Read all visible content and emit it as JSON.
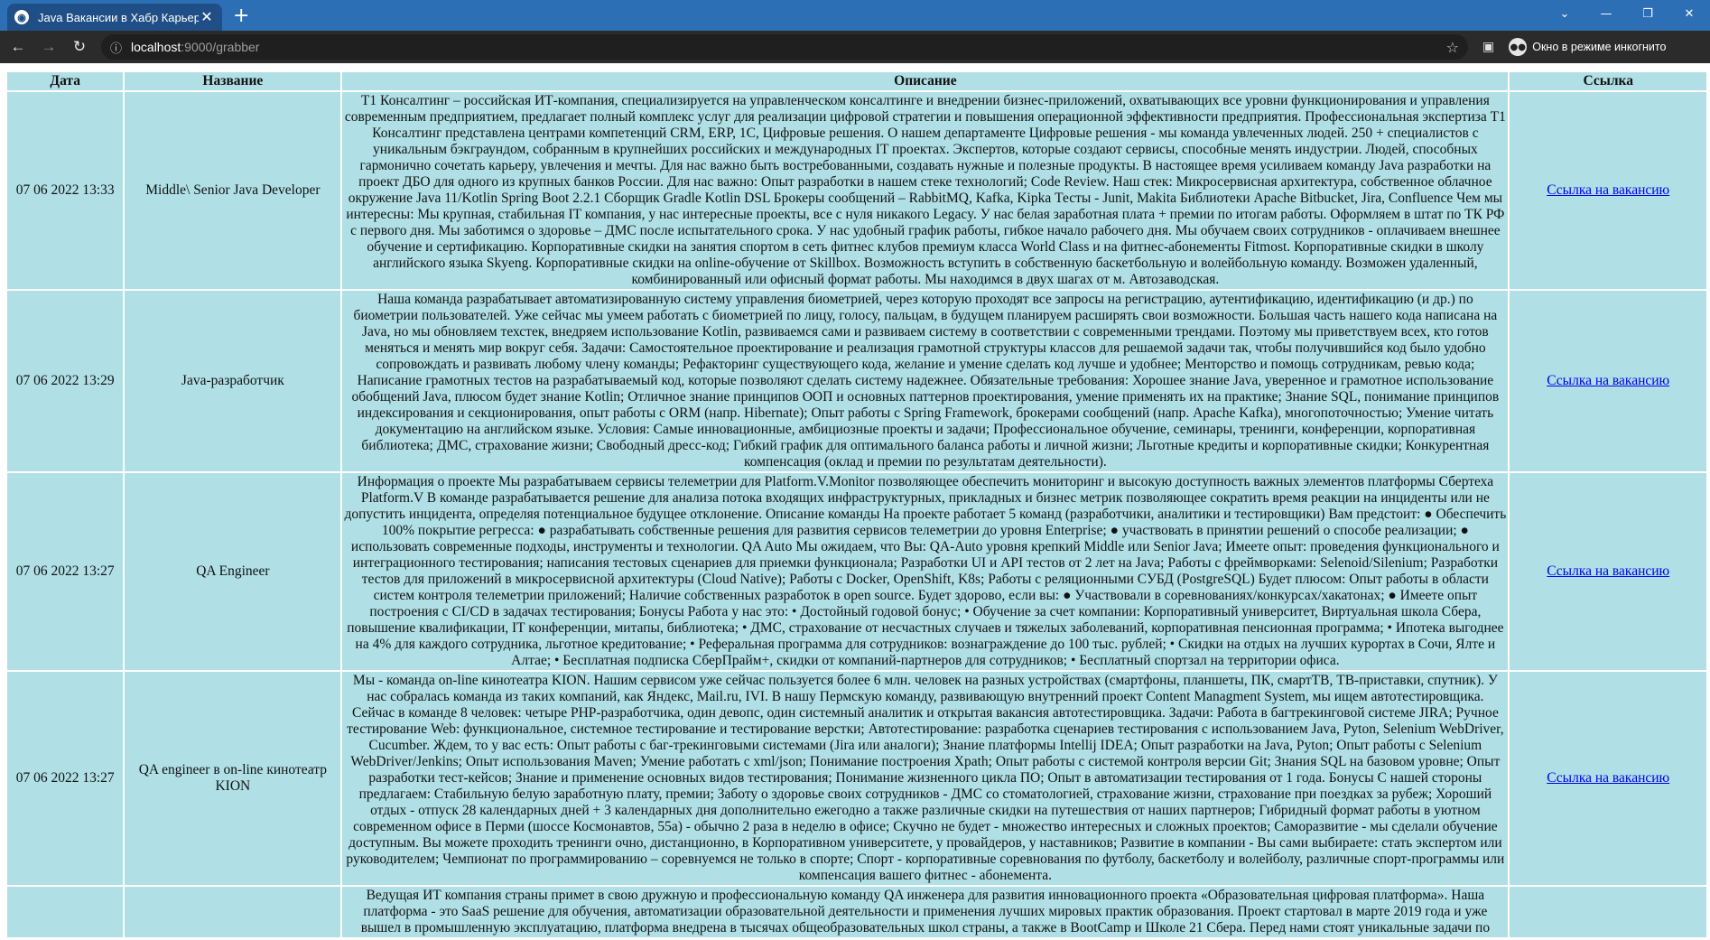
{
  "browser": {
    "tab_title": "Java Вакансии в Хабр Карьера",
    "url_host": "localhost",
    "url_path": ":9000/grabber",
    "incognito_label": "Окно в режиме инкогнито"
  },
  "table": {
    "headers": [
      "Дата",
      "Название",
      "Описание",
      "Ссылка"
    ],
    "rows": [
      {
        "date": "07 06 2022 13:33",
        "name": "Middle\\ Senior Java Developer",
        "description": "Т1 Консалтинг – российская ИТ-компания, специализируется на управленческом консалтинге и внедрении бизнес-приложений, охватывающих все уровни функционирования и управления современным предприятием, предлагает полный комплекс услуг для реализации цифровой стратегии и повышения операционной эффективности предприятия. Профессиональная экспертиза Т1 Консалтинг представлена центрами компетенций CRM, ERP, 1С, Цифровые решения. О нашем департаменте Цифровые решения - мы команда увлеченных людей. 250 + специалистов с уникальным бэкграундом, собранным в крупнейших российских и международных IT проектах. Экспертов, которые создают сервисы, способные менять индустрии. Людей, способных гармонично сочетать карьеру, увлечения и мечты. Для нас важно быть востребованными, создавать нужные и полезные продукты. В настоящее время усиливаем команду Java разработки на проект ДБО для одного из крупных банков России. Для нас важно: Опыт разработки в нашем стеке технологий; Code Review. Наш стек: Микросервисная архитектура, собственное облачное окружение Java 11/Kotlin Spring Boot 2.2.1 Сборщик Gradle Kotlin DSL Брокеры сообщений – RabbitMQ, Kafka, Kipka Тесты - Junit, Makita Библиотеки Apache Bitbucket, Jira, Confluence Чем мы интересны: Мы крупная, стабильная IT компания, у нас интересные проекты, все с нуля никакого Legacy. У нас белая заработная плата + премии по итогам работы. Оформляем в штат по ТК РФ с первого дня. Мы заботимся о здоровье – ДМС после испытательного срока. У нас удобный график работы, гибкое начало рабочего дня. Мы обучаем своих сотрудников - оплачиваем внешнее обучение и сертификацию. Корпоративные скидки на занятия спортом в сеть фитнес клубов премиум класса World Class и на фитнес-абонементы Fitmost. Корпоративные скидки в школу английского языка Skyeng. Корпоративные скидки на online-обучение от Skillbox. Возможность вступить в собственную баскетбольную и волейбольную команду. Возможен удаленный, комбинированный или офисный формат работы. Мы находимся в двух шагах от м. Автозаводская.",
        "link": "Ссылка на вакансию"
      },
      {
        "date": "07 06 2022 13:29",
        "name": "Java-разработчик",
        "description": "Наша команда разрабатывает автоматизированную систему управления биометрией, через которую проходят все запросы на регистрацию, аутентификацию, идентификацию (и др.) по биометрии пользователей. Уже сейчас мы умеем работать с биометрией по лицу, голосу, пальцам, в будущем планируем расширять свои возможности. Большая часть нашего кода написана на Java, но мы обновляем техстек, внедряем использование Kotlin, развиваемся сами и развиваем систему в соответствии с современными трендами. Поэтому мы приветствуем всех, кто готов меняться и менять мир вокруг себя. Задачи: Самостоятельное проектирование и реализация грамотной структуры классов для решаемой задачи так, чтобы получившийся код было удобно сопровождать и развивать любому члену команды; Рефакторинг существующего кода, желание и умение сделать код лучше и удобнее; Менторство и помощь сотрудникам, ревью кода; Написание грамотных тестов на разрабатываемый код, которые позволяют сделать систему надежнее. Обязательные требования: Хорошее знание Java, уверенное и грамотное использование обобщений Java, плюсом будет знание Kotlin; Отличное знание принципов ООП и основных паттернов проектирования, умение применять их на практике; Знание SQL, понимание принципов индексирования и секционирования, опыт работы с ORM (напр. Hibernate); Опыт работы с Spring Framework, брокерами сообщений (напр. Apache Kafka), многопоточностью; Умение читать документацию на английском языке. Условия: Самые инновационные, амбициозные проекты и задачи; Профессиональное обучение, семинары, тренинги, конференции, корпоративная библиотека; ДМС, страхование жизни; Свободный дресс-код; Гибкий график для оптимального баланса работы и личной жизни; Льготные кредиты и корпоративные скидки; Конкурентная компенсация (оклад и премии по результатам деятельности).",
        "link": "Ссылка на вакансию"
      },
      {
        "date": "07 06 2022 13:27",
        "name": "QA Engineer",
        "description": "Информация о проекте Мы разрабатываем сервисы телеметрии для Platform.V.Monitor позволяющее обеспечить мониторинг и высокую доступность важных элементов платформы Сбертеха Platform.V В команде разрабатывается решение для анализа потока входящих инфраструктурных, прикладных и бизнес метрик позволяющее сократить время реакции на инциденты или не допустить инцидента, определяя потенциальное будущее отклонение. Описание команды На проекте работает 5 команд (разработчики, аналитики и тестировщики) Вам предстоит: ● Обеспечить 100% покрытие регресса: ● разрабатывать собственные решения для развития сервисов телеметрии до уровня Enterprise; ● участвовать в принятии решений о способе реализации; ● использовать современные подходы, инструменты и технологии. QA Auto Мы ожидаем, что Вы: QA-Auto уровня крепкий Middle или Senior Java; Имеете опыт: проведения функционального и интеграционного тестирования; написания тестовых сценариев для приемки функционала; Разработки UI и API тестов от 2 лет на Java; Работы с фреймворками: Selenoid/Silenium; Разработки тестов для приложений в микросервисной архитектуры (Cloud Native); Работы с Docker, OpenShift, K8s; Работы с реляционными СУБД (PostgreSQL) Будет плюсом: Опыт работы в области систем контроля телеметрии приложений; Наличие собственных разработок в open source. Будет здорово, если вы: ● Участвовали в соревнованиях/конкурсах/хакатонах; ● Имеете опыт построения с CI/CD в задачах тестирования; Бонусы Работа у нас это: • Достойный годовой бонус; • Обучение за счет компании: Корпоративный университет, Виртуальная школа Сбера, повышение квалификации, IT конференции, митапы, библиотека; • ДМС, страхование от несчастных случаев и тяжелых заболеваний, корпоративная пенсионная программа; • Ипотека выгоднее на 4% для каждого сотрудника, льготное кредитование; • Реферальная программа для сотрудников: вознаграждение до 100 тыс. рублей; • Скидки на отдых на лучших курортах в Сочи, Ялте и Алтае; • Бесплатная подписка СберПрайм+, скидки от компаний-партнеров для сотрудников; • Бесплатный спортзал на территории офиса.",
        "link": "Ссылка на вакансию"
      },
      {
        "date": "07 06 2022 13:27",
        "name": "QA engineer в on-line кинотеатр KION",
        "description": "Мы - команда on-line кинотеатра KION. Нашим сервисом уже сейчас пользуется более 6 млн. человек на разных устройствах (смартфоны, планшеты, ПК, смартТВ, ТВ-приставки, спутник). У нас собралась команда из таких компаний, как Яндекс, Mail.ru, IVI. В нашу Пермскую команду, развивающую внутренний проект Content Managment System, мы ищем автотестировщика. Сейчас в команде 8 человек: четыре PHP-разработчика, один девопс, один системный аналитик и открытая вакансия автотестировщика. Задачи: Работа в багтрекинговой системе JIRA; Ручное тестирование Web: функциональное, системное тестирование и тестирование верстки; Автотестирование: разработка сценариев тестирования с использованием Java, Pyton, Selenium WebDriver, Cucumber. Ждем, то у вас есть: Опыт работы с баг-трекинговыми системами (Jira или аналоги); Знание платформы Intellij IDEA; Опыт разработки на Java, Pyton; Опыт работы с Selenium WebDriver/Jenkins; Опыт использования Maven; Умение работать с xml/json; Понимание построения Xpath; Опыт работы с системой контроля версии Git; Знания SQL на базовом уровне; Опыт разработки тест-кейсов; Знание и применение основных видов тестирования; Понимание жизненного цикла ПО; Опыт в автоматизации тестирования от 1 года. Бонусы С нашей стороны предлагаем: Стабильную белую заработную плату, премии; Заботу о здоровье своих сотрудников - ДМС со стоматологией, страхование жизни, страхование при поездках за рубеж; Хороший отдых - отпуск 28 календарных дней + 3 календарных дня дополнительно ежегодно а также различные скидки на путешествия от наших партнеров; Гибридный формат работы в уютном современном офисе в Перми (шоссе Космонавтов, 55а) - обычно 2 раза в неделю в офисе; Скучно не будет - множество интересных и сложных проектов; Саморазвитие - мы сделали обучение доступным. Вы можете проходить тренинги очно, дистанционно, в Корпоративном университете, у провайдеров, у наставников; Развитие в компании - Вы сами выбираете: стать экспертом или руководителем; Чемпионат по программированию – соревнуемся не только в спорте; Спорт - корпоративные соревнования по футболу, баскетболу и волейболу, различные спорт-программы или компенсация вашего фитнес - абонемента.",
        "link": "Ссылка на вакансию"
      },
      {
        "date": "",
        "name": "",
        "description": "Ведущая ИТ компания страны примет в свою дружную и профессиональную команду QA инженера для развития инновационного проекта «Образовательная цифровая платформа». Наша платформа - это SaaS решение для обучения, автоматизации образовательной деятельности и применения лучших мировых практик образования. Проект стартовал в марте 2019 года и уже вышел в промышленную эксплуатацию, платформа внедрена в тысячах общеобразовательных школ страны, а также в BootCamp и Школе 21 Сбера. Перед нами стоят уникальные задачи по",
        "link": ""
      }
    ]
  }
}
